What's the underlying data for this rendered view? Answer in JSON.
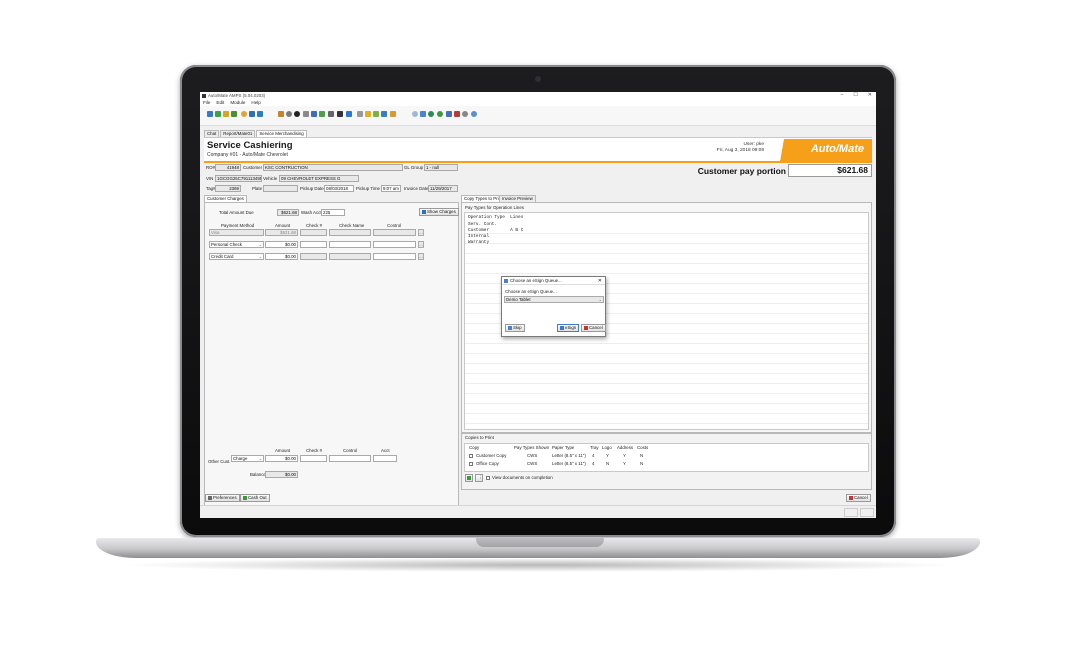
{
  "window": {
    "title": "Auto/Mate AMPS (5.04.0203)",
    "controls": [
      "–",
      "☐",
      "✕"
    ]
  },
  "menu": [
    "File",
    "Edit",
    "Module",
    "Help"
  ],
  "tabs": [
    "Chat",
    "Report/Mate01",
    "Service Merchandising"
  ],
  "header": {
    "title": "Service Cashiering",
    "company": "Company #01 - Auto/Mate Chevrolet",
    "user": "User: pke",
    "datetime": "Fri, Aug 3, 2018 09:09",
    "logo": "Auto/Mate"
  },
  "ro_info": {
    "ro_label": "RO#",
    "ro_value": "41948",
    "customer_label": "Customer",
    "customer_value": "KSC CONTRUCTION",
    "gl_group_label": "GL Group",
    "gl_group_value": "1 - null",
    "vin_label": "VIN",
    "vin_value": "1GCGG25C791113495",
    "vehicle_label": "Vehicle",
    "vehicle_value": "09 CHEVROLET EXPRESS G",
    "tag_label": "Tag#",
    "tag_value": "2369",
    "plate_label": "Plate",
    "plate_value": "",
    "pickup_date_label": "Pickup Date",
    "pickup_date_value": "08/03/2018",
    "pickup_time_label": "Pickup Time",
    "pickup_time_value": "9:07 am",
    "invoice_date_label": "Invoice Date",
    "invoice_date_value": "11/29/2017"
  },
  "customer_pay": {
    "label": "Customer pay portion",
    "amount": "$621.68"
  },
  "customer_charges": {
    "tab": "Customer Charges",
    "total_label": "Total Amount Due",
    "total_value": "$621.68",
    "wash_label": "Wash Acct",
    "wash_value": "225",
    "show_charges": "Show Charges",
    "columns": [
      "Payment Method",
      "Amount",
      "Check #",
      "Check Name",
      "Control"
    ],
    "rows": [
      {
        "method": "Visa",
        "amount": "$621.68"
      },
      {
        "method": "Personal Check",
        "amount": "$0.00"
      },
      {
        "method": "Credit Card",
        "amount": "$0.00"
      }
    ]
  },
  "other_cust": {
    "columns": [
      "Amount",
      "Check #",
      "Control",
      "Acct"
    ],
    "label": "Other Cust.",
    "select": "Charge",
    "amount": "$0.00",
    "balance_label": "Balance",
    "balance_value": "$0.00"
  },
  "right_tabs": [
    "Copy Types to Print",
    "Invoice Preview"
  ],
  "pay_types": {
    "title": "Pay Types for Operation Lines",
    "lines": [
      "Operation Type  Lines",
      "Serv. Cont.",
      "Customer        A B C",
      "Internal",
      "Warranty"
    ]
  },
  "esign_dialog": {
    "title": "Choose an eSign Queue...",
    "prompt": "Choose an eSign Queue...",
    "selected": "Demo Tablet",
    "skip": "Skip",
    "esign": "eSign",
    "cancel": "Cancel"
  },
  "copies": {
    "title": "Copies to Print",
    "columns": [
      "Copy",
      "Pay Types Shown",
      "Paper Type",
      "Tray",
      "Logo",
      "Address",
      "Costs"
    ],
    "rows": [
      {
        "copy": "Customer Copy",
        "pay": "CWS",
        "paper": "Letter (8.5\" x 11\")",
        "tray": "4",
        "logo": "Y",
        "address": "Y",
        "costs": "N"
      },
      {
        "copy": "Office Copy",
        "pay": "CWS",
        "paper": "Letter (8.5\" x 11\")",
        "tray": "4",
        "logo": "N",
        "address": "Y",
        "costs": "N"
      }
    ],
    "view_docs": "View documents on completion"
  },
  "footer": {
    "preferences": "Preferences",
    "cashout": "Cash Out",
    "cancel": "Cancel"
  },
  "colors": {
    "brand_orange": "#f6a01a",
    "window_bg": "#f0f0f0"
  }
}
